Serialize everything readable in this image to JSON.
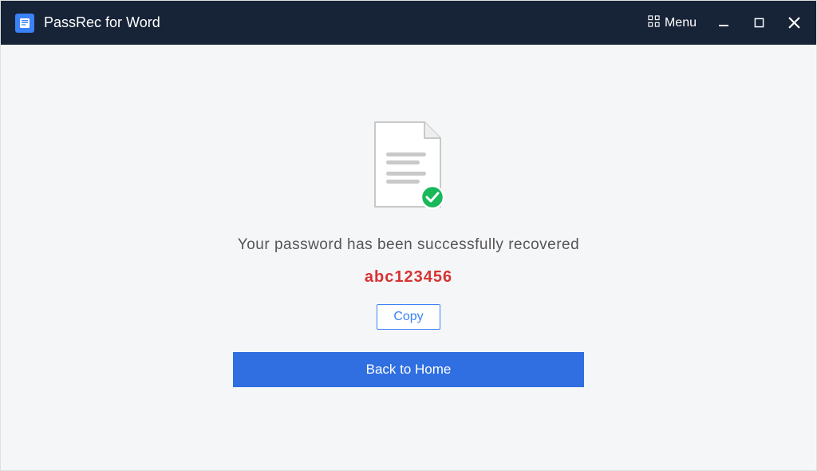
{
  "titlebar": {
    "app_name": "PassRec for Word",
    "menu_label": "Menu"
  },
  "result": {
    "message": "Your password has been successfully recovered",
    "password": "abc123456",
    "copy_label": "Copy",
    "home_label": "Back to Home"
  },
  "colors": {
    "titlebar_bg": "#172337",
    "accent": "#2f6fe1",
    "password": "#d63333"
  }
}
